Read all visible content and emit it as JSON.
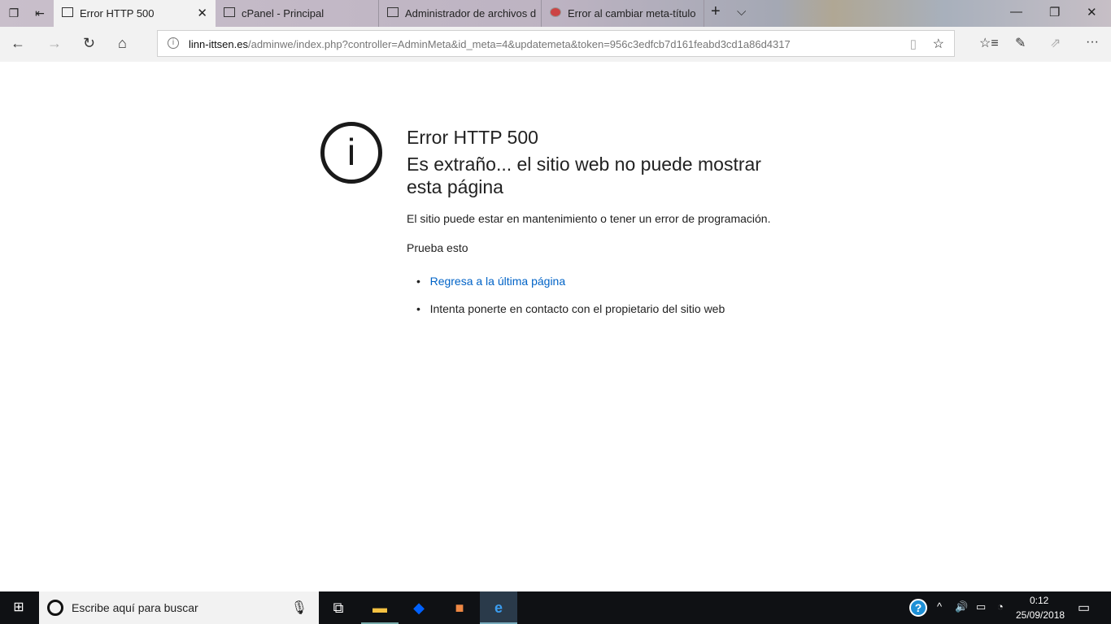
{
  "browser": {
    "tabs": [
      {
        "label": "Error HTTP 500",
        "active": true
      },
      {
        "label": "cPanel - Principal",
        "active": false
      },
      {
        "label": "Administrador de archivos d",
        "active": false
      },
      {
        "label": "Error al cambiar meta-título",
        "active": false
      }
    ],
    "url_domain": "linn-ittsen.es",
    "url_path": "/adminwe/index.php?controller=AdminMeta&id_meta=4&updatemeta&token=956c3edfcb7d161feabd3cd1a86d4317"
  },
  "page": {
    "title": "Error HTTP 500",
    "subtitle": "Es extraño... el sitio web no puede mostrar esta página",
    "description": "El sitio puede estar en mantenimiento o tener un error de programación.",
    "try_label": "Prueba esto",
    "suggestions": [
      "Regresa a la última página",
      "Intenta ponerte en contacto con el propietario del sitio web"
    ],
    "link_color": "#0063c7"
  },
  "taskbar": {
    "search_placeholder": "Escribe aquí para buscar",
    "time": "0:12",
    "date": "25/09/2018"
  }
}
